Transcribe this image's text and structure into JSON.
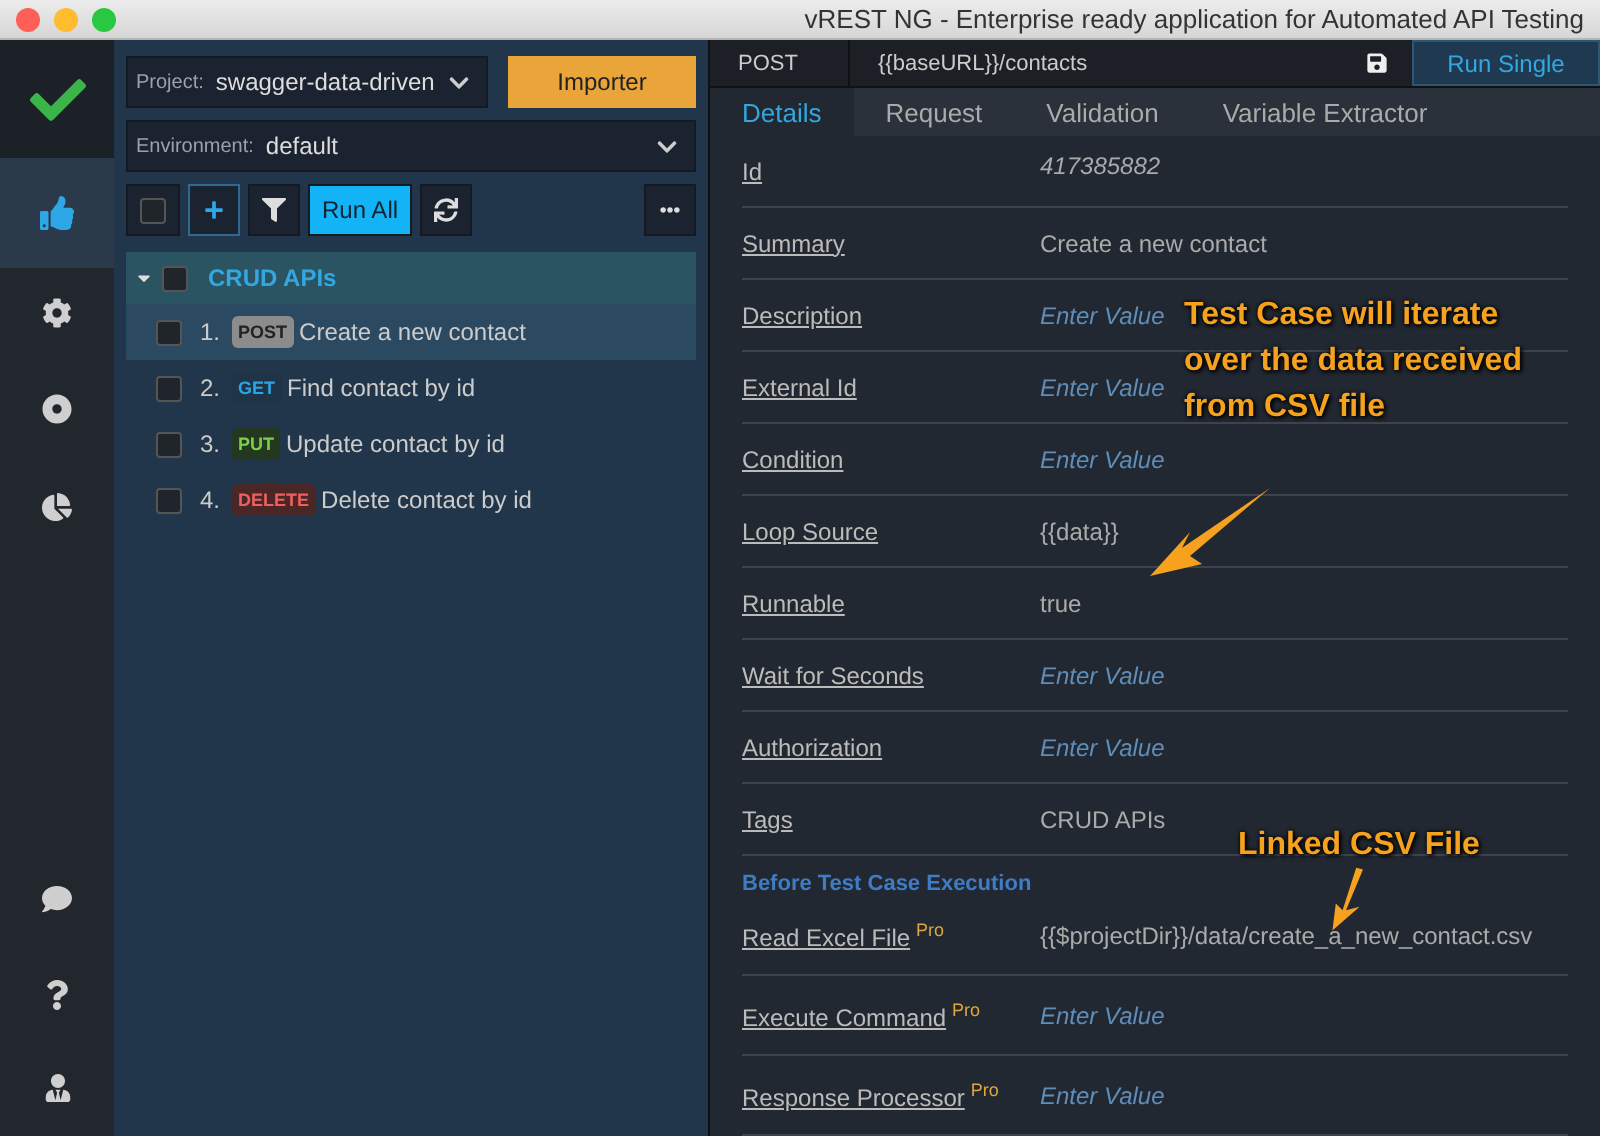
{
  "window": {
    "title": "vREST NG - Enterprise ready application for Automated API Testing"
  },
  "nav_items": [
    {
      "selected": false
    },
    {
      "selected": true
    },
    {
      "selected": false
    },
    {
      "selected": false
    },
    {
      "selected": false
    },
    {
      "selected": false
    },
    {
      "selected": false
    },
    {
      "selected": false
    }
  ],
  "project": {
    "label": "Project:",
    "value": "swagger-data-driven"
  },
  "importer_button": "Importer",
  "environment": {
    "label": "Environment:",
    "value": "default"
  },
  "toolbar": {
    "select_all_checked": false,
    "run_all": "Run All"
  },
  "tree": [
    {
      "label": "CRUD APIs",
      "expanded": true,
      "checked": false,
      "children": [
        {
          "number": "1.",
          "method": "POST",
          "label": "Create a new contact",
          "selected": true,
          "checked": false
        },
        {
          "number": "2.",
          "method": "GET",
          "label": "Find contact by id",
          "selected": false,
          "checked": false
        },
        {
          "number": "3.",
          "method": "PUT",
          "label": "Update contact by id",
          "selected": false,
          "checked": false
        },
        {
          "number": "4.",
          "method": "DELETE",
          "label": "Delete contact by id",
          "selected": false,
          "checked": false
        }
      ]
    }
  ],
  "request_bar": {
    "method": "POST",
    "url": "{{baseURL}}/contacts",
    "run_button": "Run Single"
  },
  "tabs": [
    {
      "label": "Details",
      "selected": true
    },
    {
      "label": "Request",
      "selected": false
    },
    {
      "label": "Validation",
      "selected": false
    },
    {
      "label": "Variable Extractor",
      "selected": false
    }
  ],
  "fields": [
    {
      "kind": "readonly",
      "label": "Id",
      "value": "417385882"
    },
    {
      "kind": "field",
      "label": "Summary",
      "value": "Create a new contact"
    },
    {
      "kind": "field",
      "label": "Description",
      "placeholder": "Enter Value"
    },
    {
      "kind": "field",
      "label": "External Id",
      "placeholder": "Enter Value"
    },
    {
      "kind": "field",
      "label": "Condition",
      "placeholder": "Enter Value"
    },
    {
      "kind": "field",
      "label": "Loop Source",
      "value": "{{data}}"
    },
    {
      "kind": "field",
      "label": "Runnable",
      "value": "true"
    },
    {
      "kind": "field",
      "label": "Wait for Seconds",
      "placeholder": "Enter Value"
    },
    {
      "kind": "field",
      "label": "Authorization",
      "placeholder": "Enter Value"
    },
    {
      "kind": "field",
      "label": "Tags",
      "value": "CRUD APIs"
    },
    {
      "kind": "section",
      "label": "Before Test Case Execution"
    },
    {
      "kind": "field",
      "label": "Read Excel File",
      "badge": "Pro",
      "value": "{{$projectDir}}/data/create_a_new_contact.csv"
    },
    {
      "kind": "field",
      "label": "Execute Command",
      "badge": "Pro",
      "placeholder": "Enter Value"
    },
    {
      "kind": "field",
      "label": "Response Processor",
      "badge": "Pro",
      "placeholder": "Enter Value"
    }
  ],
  "annotations": [
    {
      "text": "Test Case will iterate over the data received from CSV file"
    },
    {
      "text": "Linked CSV File"
    }
  ]
}
